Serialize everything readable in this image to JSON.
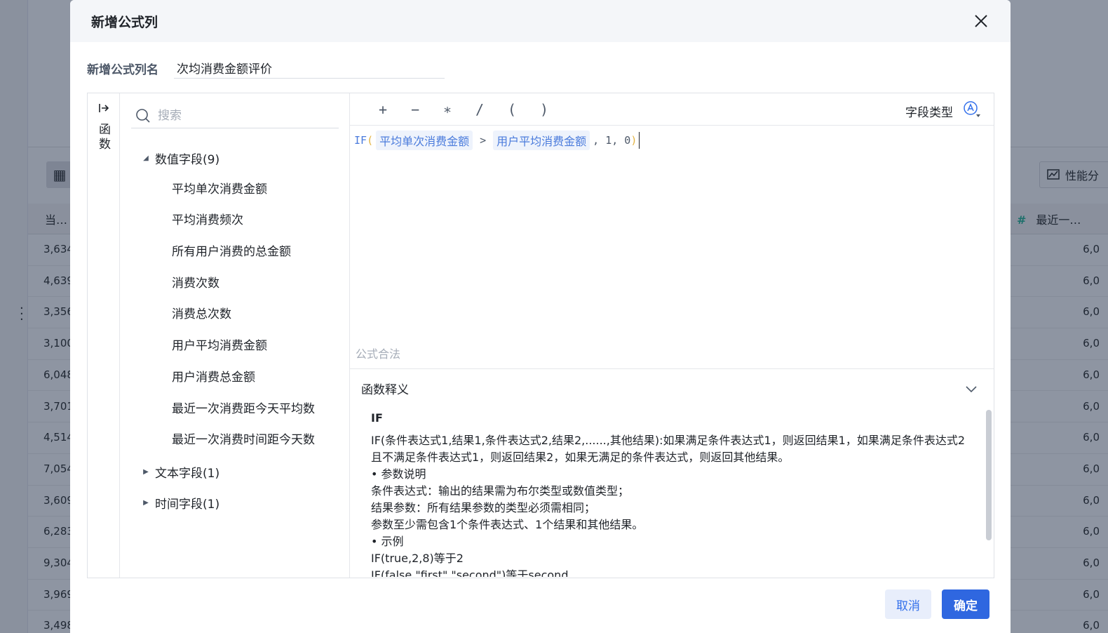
{
  "background": {
    "left_col_header": "当…",
    "right_col_header": "最近一…",
    "perf_button": "性能分",
    "left_values": [
      "3,634",
      "4,639",
      "3,356",
      "3,100",
      "6,048",
      "3,701",
      "4,514",
      "7,054",
      "3,609",
      "6,283",
      "9,304",
      "3,969",
      "3,498"
    ],
    "right_values": [
      "6,0",
      "6,0",
      "6,0",
      "6,0",
      "6,0",
      "6,0",
      "6,0",
      "6,0",
      "6,0",
      "6,0",
      "6,0",
      "6,0",
      "6,0"
    ]
  },
  "dialog": {
    "title": "新增公式列",
    "name_label": "新增公式列名",
    "name_value": "次均消费金额评价",
    "side_tab_label": "函数",
    "search_placeholder": "搜索",
    "tree": {
      "numeric_group": "数值字段(9)",
      "numeric_fields": [
        "平均单次消费金额",
        "平均消费频次",
        "所有用户消费的总金额",
        "消费次数",
        "消费总次数",
        "用户平均消费金额",
        "用户消费总金额",
        "最近一次消费距今天平均数",
        "最近一次消费时间距今天数"
      ],
      "text_group": "文本字段(1)",
      "time_group": "时间字段(1)"
    },
    "operators": [
      "+",
      "−",
      "∗",
      "/",
      "(",
      ")"
    ],
    "field_type_label": "字段类型",
    "formula": {
      "fn": "IF",
      "open": "(",
      "field1": "平均单次消费金额",
      "op": ">",
      "field2": "用户平均消费金额",
      "rest": ", 1, 0",
      "close": ")"
    },
    "validation": "公式合法",
    "func_panel": {
      "header": "函数释义",
      "name": "IF",
      "lines": [
        "IF(条件表达式1,结果1,条件表达式2,结果2,......,其他结果):如果满足条件表达式1，则返回结果1，如果满足条件表达式2且不满足条件表达式1，则返回结果2，如果无满足的条件表达式，则返回其他结果。",
        "• 参数说明",
        "条件表达式：输出的结果需为布尔类型或数值类型；",
        "结果参数：所有结果参数的类型必须需相同；",
        "参数至少需包含1个条件表达式、1个结果和其他结果。",
        "• 示例",
        "IF(true,2,8)等于2",
        "IF(false,\"first\",\"second\")等于second"
      ]
    },
    "cancel": "取消",
    "ok": "确定"
  }
}
